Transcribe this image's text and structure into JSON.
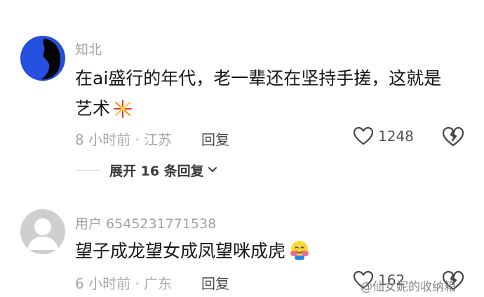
{
  "comments": [
    {
      "username": "知北",
      "text_line1": "在ai盛行的年代，老一辈还在坚持手搓，这就是",
      "text_line2": "艺术",
      "emoji_icon": "firework-emoji-icon",
      "time_location": "8 小时前 · 江苏",
      "reply_label": "回复",
      "like_count": "1248",
      "expand_label": "展开 16 条回复"
    },
    {
      "username": "用户 6545231771538",
      "text_line1": "望子成龙望女成凤望咪成虎",
      "emoji_icon": "hugging-face-emoji-icon",
      "time_location": "6 小时前 · 广东",
      "reply_label": "回复",
      "like_count": "162"
    }
  ],
  "watermark": "@仙女妮的收纳箱",
  "colors": {
    "username": "#a3a3a3",
    "text": "#161616",
    "meta": "#a8a8a8",
    "avatar1_bg": "#1f4bd8",
    "avatar2_bg": "#cfcfcf"
  }
}
